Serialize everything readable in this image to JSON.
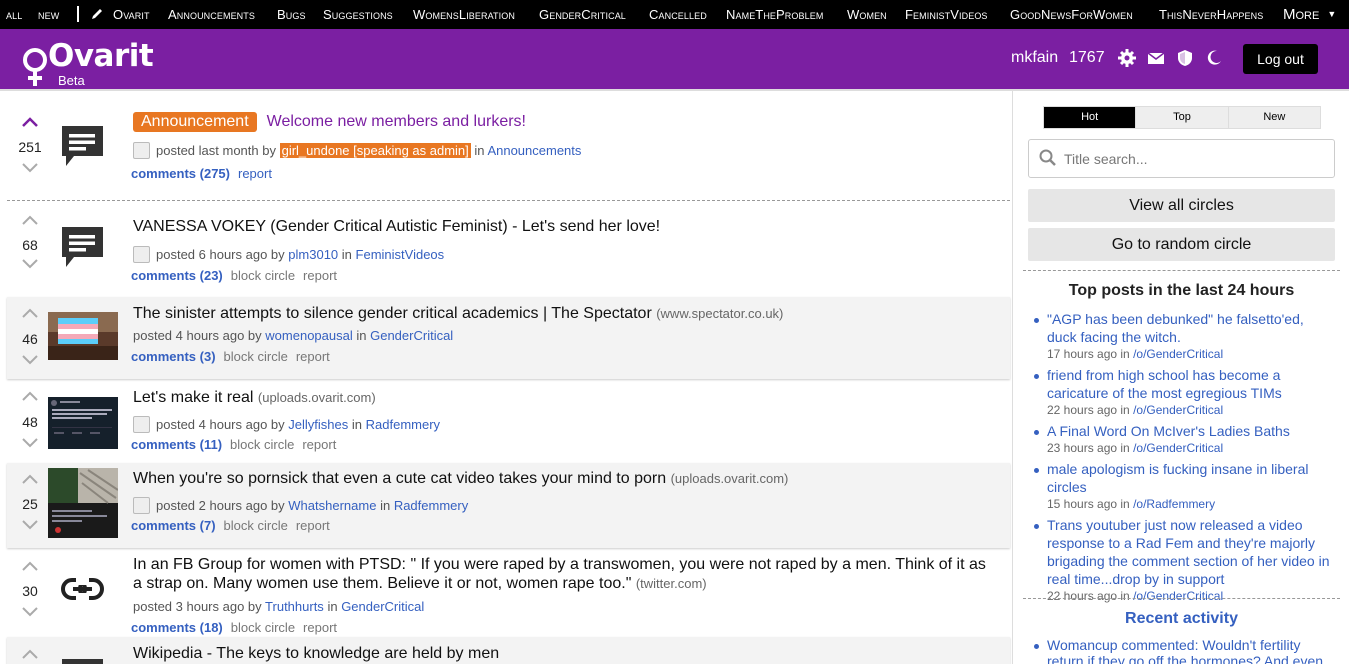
{
  "topnav": {
    "items": [
      "all",
      "new",
      "Ovarit",
      "Announcements",
      "Bugs",
      "Suggestions",
      "WomensLiberation",
      "GenderCritical",
      "Cancelled",
      "NameTheProblem",
      "Women",
      "FeministVideos",
      "GoodNewsForWomen",
      "ThisNeverHappens"
    ],
    "more_label": "More",
    "more_icon": "chevron-down-icon",
    "pencil_icon": "pencil-icon"
  },
  "header": {
    "logo_text": "Ovarit",
    "logo_sub": "Beta",
    "username": "mkfain",
    "karma": "1767",
    "icons": [
      "gear-icon",
      "mail-icon",
      "shield-icon",
      "moon-icon"
    ],
    "logout_label": "Log out",
    "bg_color": "#7b1fa2"
  },
  "posts": [
    {
      "score": "251",
      "badge": "Announcement",
      "title": "Welcome new members and lurkers!",
      "posted": "posted last month by",
      "user": "girl_undone [speaking as admin]",
      "in_text": "in",
      "circle": "Announcements",
      "comments": "comments (275)",
      "report": "report"
    },
    {
      "score": "68",
      "title": "VANESSA VOKEY (Gender Critical Autistic Feminist) - Let's send her love!",
      "posted": "posted 6 hours ago by",
      "user": "plm3010",
      "in_text": "in",
      "circle": "FeministVideos",
      "comments": "comments (23)",
      "block": "block circle",
      "report": "report"
    },
    {
      "score": "46",
      "title": "The sinister attempts to silence gender critical academics | The Spectator",
      "domain": "(www.spectator.co.uk)",
      "posted": "posted 4 hours ago by",
      "user": "womenopausal",
      "in_text": "in",
      "circle": "GenderCritical",
      "comments": "comments (3)",
      "block": "block circle",
      "report": "report"
    },
    {
      "score": "48",
      "title": "Let's make it real",
      "domain": "(uploads.ovarit.com)",
      "posted": "posted 4 hours ago by",
      "user": "Jellyfishes",
      "in_text": "in",
      "circle": "Radfemmery",
      "comments": "comments (11)",
      "block": "block circle",
      "report": "report"
    },
    {
      "score": "25",
      "title": "When you're so pornsick that even a cute cat video takes your mind to porn",
      "domain": "(uploads.ovarit.com)",
      "posted": "posted 2 hours ago by",
      "user": "Whatshername",
      "in_text": "in",
      "circle": "Radfemmery",
      "comments": "comments (7)",
      "block": "block circle",
      "report": "report"
    },
    {
      "score": "30",
      "title_line1": "In an FB Group for women with PTSD: \" If you were raped by a transwomen, you were not raped by a men. Think of it as",
      "title_line2": "a strap on. Many women use them. Believe it or not, women rape too.\"",
      "domain": "(twitter.com)",
      "posted": "posted 3 hours ago by",
      "user": "Truthhurts",
      "in_text": "in",
      "circle": "GenderCritical",
      "comments": "comments (18)",
      "block": "block circle",
      "report": "report"
    },
    {
      "title": "Wikipedia - The keys to knowledge are held by men"
    }
  ],
  "sidebar": {
    "tabs": [
      "Hot",
      "Top",
      "New"
    ],
    "active_tab": "Hot",
    "search_placeholder": "Title search...",
    "view_all": "View all circles",
    "random": "Go to random circle",
    "top_heading": "Top posts in the last 24 hours",
    "top_posts": [
      {
        "title": "\"AGP has been debunked\" he falsetto'ed, duck facing the witch.",
        "when": "17 hours ago in",
        "circle": "/o/GenderCritical"
      },
      {
        "title": "friend from high school has become a caricature of the most egregious TIMs",
        "when": "22 hours ago in",
        "circle": "/o/GenderCritical"
      },
      {
        "title": "A Final Word On McIver's Ladies Baths",
        "when": "23 hours ago in",
        "circle": "/o/GenderCritical"
      },
      {
        "title": "male apologism is fucking insane in liberal circles",
        "when": "15 hours ago in",
        "circle": "/o/Radfemmery"
      },
      {
        "title": "Trans youtuber just now released a video response to a Rad Fem and they're majorly brigading the comment section of her video in real time...drop by in support",
        "when": "22 hours ago in",
        "circle": "/o/GenderCritical"
      }
    ],
    "activity_heading": "Recent activity",
    "activity_user": "Womancup commented:",
    "activity_text": "Wouldn't fertility return if they go off the hormones? And even"
  }
}
